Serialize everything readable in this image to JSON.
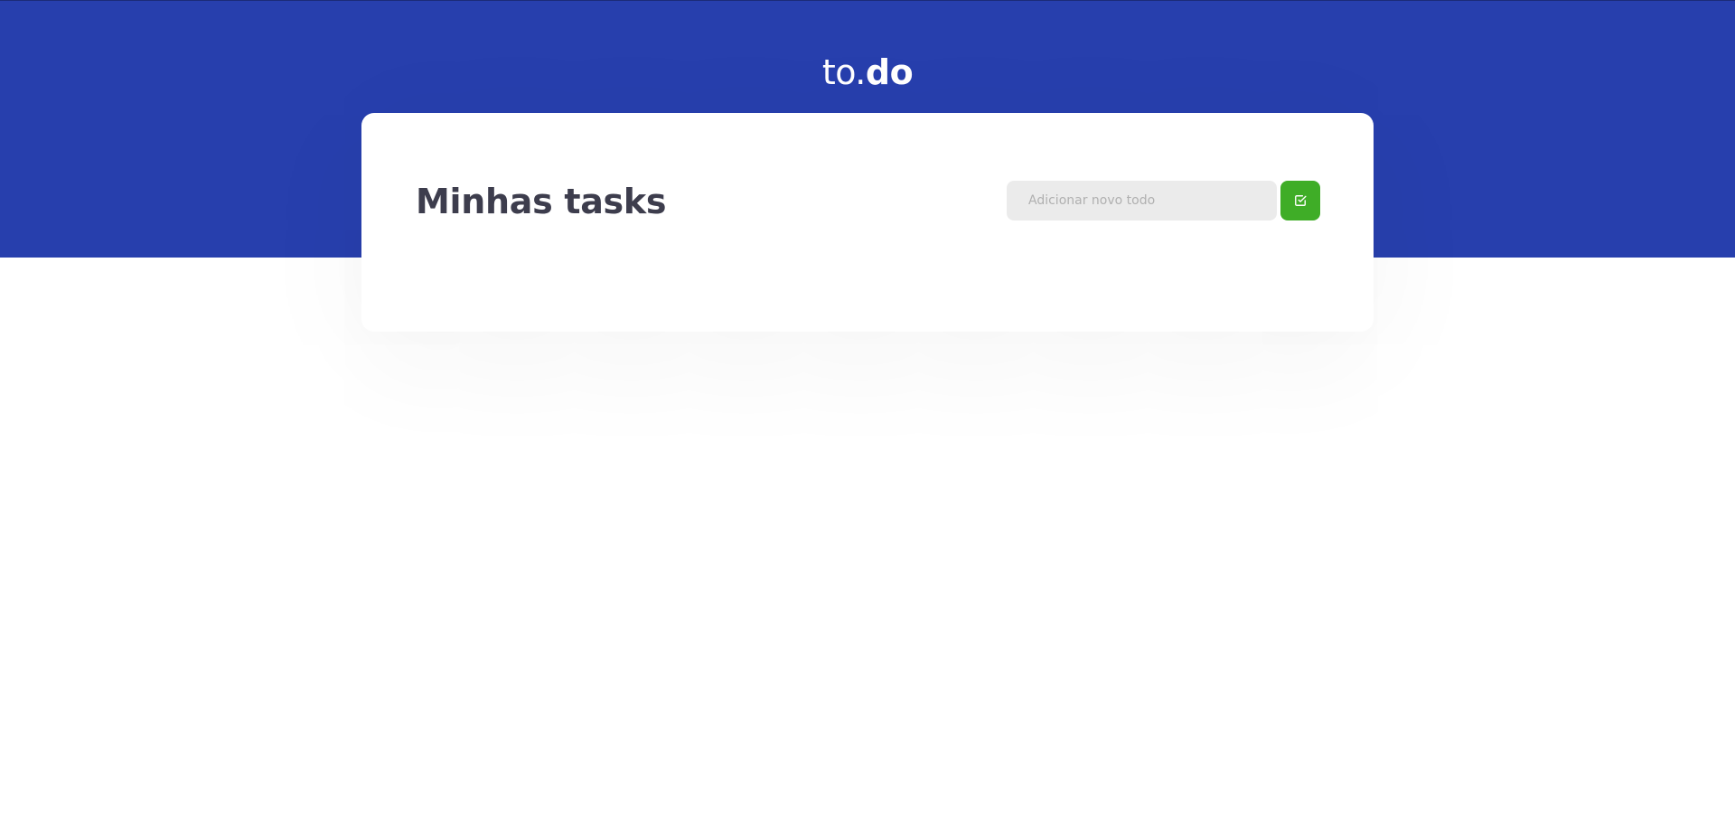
{
  "header": {
    "logo_light": "to.",
    "logo_bold": "do"
  },
  "main": {
    "title": "Minhas tasks",
    "new_todo": {
      "placeholder": "Adicionar novo todo",
      "value": ""
    },
    "add_button": {
      "icon": "check-square-icon"
    }
  },
  "colors": {
    "header_bg": "#273fad",
    "accent_green": "#3fad27",
    "title_text": "#3d3d4d",
    "input_bg": "#ebebeb"
  }
}
